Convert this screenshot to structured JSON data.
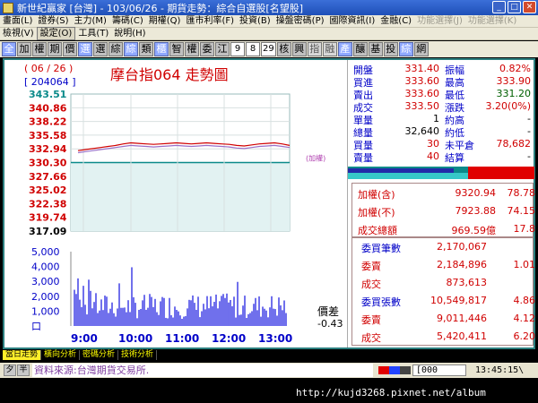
{
  "window": {
    "title": "新世紀贏家 [台灣] - 103/06/26 - 期貨走勢：綜合自選股[名望股]"
  },
  "menu_row1": [
    "畫面(L)",
    "證券(S)",
    "主力(M)",
    "籌碼(C)",
    "期權(Q)",
    "匯市利率(F)",
    "投資(B)",
    "操盤密碼(P)",
    "國際資訊(I)",
    "金融(C)",
    "功能選擇(J)",
    "功能選擇(K)"
  ],
  "menu_row2": [
    "檢視(V)",
    "設定(O)",
    "工具(T)",
    "說明(H)"
  ],
  "toolbar": [
    "全",
    "加",
    "權",
    "期",
    "價",
    "選",
    "選",
    "綜",
    "綜",
    "類",
    "櫃",
    "智",
    "權",
    "委",
    "江",
    "9",
    "8",
    "29",
    "核",
    "興",
    "指",
    "融",
    "產",
    "釀",
    "基",
    "投",
    "綜",
    "網"
  ],
  "chart": {
    "date_label": "( 06 / 26 )",
    "title": "摩台指064  走勢圖",
    "volume_label": "[ 204064 ]",
    "diff_label": "價差",
    "diff_value": "-0.43",
    "ref_marker": "(加權)"
  },
  "chart_data": {
    "type": "line",
    "price_ticks": [
      "343.51",
      "340.86",
      "338.22",
      "335.58",
      "332.94",
      "330.30",
      "327.66",
      "325.02",
      "322.38",
      "319.74",
      "317.09"
    ],
    "price_tick_colors": [
      "#0a8a8a",
      "#d00000",
      "#d00000",
      "#d00000",
      "#d00000",
      "#d00000",
      "#d00000",
      "#d00000",
      "#d00000",
      "#d00000",
      "#000000"
    ],
    "reference_price": 330.3,
    "ylim": [
      317.09,
      343.51
    ],
    "volume_ticks": [
      "5,000",
      "4,000",
      "3,000",
      "2,000",
      "1,000",
      "口"
    ],
    "x_ticks": [
      "9:00",
      "10:00",
      "11:00",
      "12:00",
      "13:00"
    ],
    "series": [
      {
        "values": [
          332.6,
          332.8,
          333.0,
          333.2,
          333.4,
          333.6,
          333.9,
          334.1,
          334.0,
          333.9,
          333.8,
          333.9,
          334.0,
          334.1,
          334.0,
          333.9,
          334.0,
          334.1,
          334.0,
          333.9,
          333.8,
          333.6,
          333.5,
          333.7,
          333.9,
          334.0,
          334.1,
          333.9,
          333.6
        ]
      },
      {
        "values": [
          332.2,
          332.4,
          332.6,
          332.8,
          333.0,
          333.2,
          333.4,
          333.6,
          333.5,
          333.4,
          333.3,
          333.4,
          333.5,
          333.6,
          333.5,
          333.4,
          333.5,
          333.6,
          333.5,
          333.4,
          333.3,
          333.1,
          333.0,
          333.2,
          333.4,
          333.5,
          333.6,
          333.4,
          333.2
        ]
      }
    ]
  },
  "quote": {
    "rows": [
      {
        "l1": "開盤",
        "v1": "331.40",
        "l2": "振幅",
        "v2": "0.82%"
      },
      {
        "l1": "買進",
        "v1": "333.60",
        "l2": "最高",
        "v2": "333.90"
      },
      {
        "l1": "賣出",
        "v1": "333.60",
        "l2": "最低",
        "v2": "331.20"
      },
      {
        "l1": "成交",
        "v1": "333.50",
        "l2": "漲跌",
        "v2": "3.20(0%)"
      },
      {
        "l1": "單量",
        "v1": "1",
        "l2": "約高",
        "v2": "-"
      },
      {
        "l1": "總量",
        "v1": "32,640",
        "l2": "約低",
        "v2": "-"
      },
      {
        "l1": "買量",
        "v1": "30",
        "l2": "未平倉",
        "v2": "78,682"
      },
      {
        "l1": "賣量",
        "v1": "40",
        "l2": "結算",
        "v2": "-"
      }
    ],
    "index_rows": [
      {
        "label": "加權(含)",
        "value": "9320.94",
        "extra": "78.78"
      },
      {
        "label": "加權(不)",
        "value": "7923.88",
        "extra": "74.15"
      },
      {
        "label": "成交總額",
        "value": "969.59億",
        "extra": "17.8"
      }
    ],
    "order_rows": [
      {
        "label": "委買筆數",
        "value": "2,170,067",
        "extra": ""
      },
      {
        "label": "委賣",
        "value": "2,184,896",
        "extra": "1.01"
      },
      {
        "label": "成交",
        "value": "873,613",
        "extra": ""
      },
      {
        "label": "委買張數",
        "value": "10,549,817",
        "extra": "4.86"
      },
      {
        "label": "委賣",
        "value": "9,011,446",
        "extra": "4.12"
      },
      {
        "label": "成交",
        "value": "5,420,411",
        "extra": "6.20"
      }
    ]
  },
  "tabs": [
    "當日走勢",
    "橫向分析",
    "密碼分析",
    "技術分析"
  ],
  "status": {
    "source": "資料來源:台灣期貨交易所.",
    "code": "[000",
    "time": "13:45:15\\",
    "icon1": "夕",
    "icon2": "半"
  },
  "watermark": "http://kujd3268.pixnet.net/album"
}
